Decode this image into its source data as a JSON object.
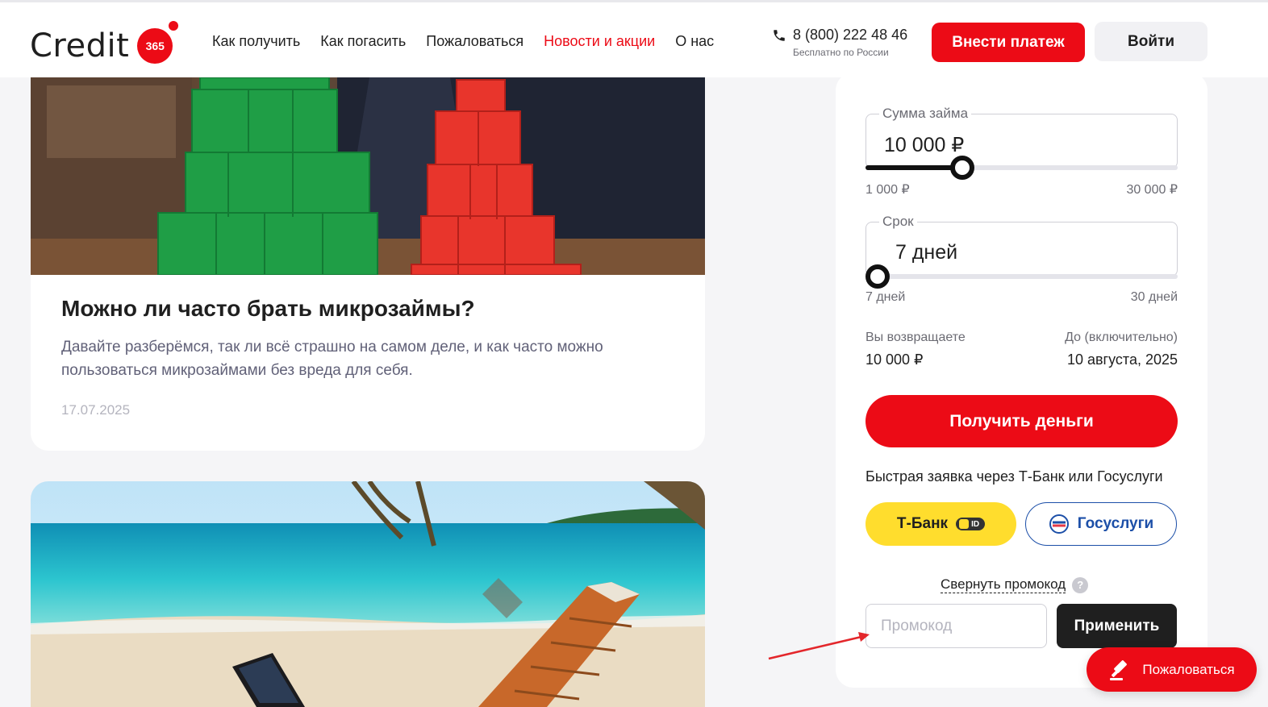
{
  "header": {
    "logo_text": "Credit",
    "logo_badge": "365",
    "nav": [
      "Как получить",
      "Как погасить",
      "Пожаловаться",
      "Новости и акции",
      "О нас"
    ],
    "active_nav": "Новости и акции",
    "phone": "8 (800) 222 48 46",
    "phone_note": "Бесплатно по России",
    "pay_button": "Внести платеж",
    "login_button": "Войти"
  },
  "articles": [
    {
      "title": "Можно ли часто брать микрозаймы?",
      "description": "Давайте разберёмся, так ли всё страшно на самом деле, и как часто можно пользоваться микрозаймами без вреда для себя.",
      "date": "17.07.2025"
    }
  ],
  "loan_form": {
    "amount_label": "Сумма займа",
    "amount_value": "10 000 ₽",
    "amount_min": "1 000 ₽",
    "amount_max": "30 000 ₽",
    "amount_slider_fraction": 0.31,
    "term_label": "Срок",
    "term_value": "7 дней",
    "term_min": "7 дней",
    "term_max": "30 дней",
    "term_slider_fraction": 0.0,
    "return_label": "Вы возвращаете",
    "return_value": "10 000 ₽",
    "due_label": "До (включительно)",
    "due_value": "10 августа, 2025",
    "get_money_button": "Получить деньги",
    "quick_apply_text": "Быстрая заявка через Т-Банк или Госуслуги",
    "tbank_button": "Т-Банк",
    "tbank_badge": "ID",
    "gosuslugi_button": "Госуслуги",
    "promo_toggle": "Свернуть промокод",
    "promo_help": "?",
    "promo_placeholder": "Промокод",
    "promo_value": "",
    "apply_button": "Применить"
  },
  "complain_button": "Пожаловаться",
  "colors": {
    "brand_red": "#ec0b16",
    "tbank_yellow": "#ffdd2d",
    "gosuslugi_blue": "#1c4fa8",
    "dark": "#1f1f1f"
  },
  "icons": [
    "phone-icon",
    "gavel-icon",
    "tbank-id-icon",
    "gosuslugi-logo-icon",
    "help-icon",
    "annotation-arrow"
  ]
}
